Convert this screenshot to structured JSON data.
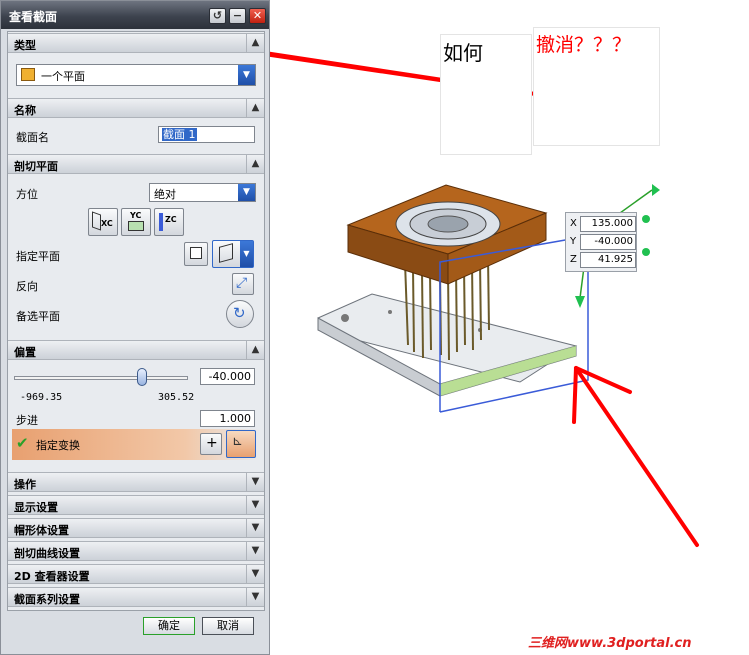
{
  "dialog": {
    "title": "查看截面",
    "sections": {
      "type": {
        "header": "类型",
        "value": "一个平面"
      },
      "name": {
        "header": "名称",
        "label": "截面名",
        "value": "截面 1"
      },
      "cutting_plane": {
        "header": "剖切平面",
        "orientation_label": "方位",
        "orientation_value": "绝对",
        "axis_buttons": [
          "XC",
          "YC",
          "ZC"
        ],
        "specify_plane_label": "指定平面",
        "reverse_label": "反向",
        "alternate_plane_label": "备选平面"
      },
      "offset": {
        "header": "偏置",
        "value": "-40.000",
        "slider_min": "-969.35",
        "slider_max": "305.52",
        "slider_fraction": 0.73,
        "step_label": "步进",
        "step_value": "1.000",
        "specify_transform_label": "指定变换"
      },
      "collapsed": [
        "操作",
        "显示设置",
        "帽形体设置",
        "剖切曲线设置",
        "2D 查看器设置",
        "截面系列设置"
      ]
    },
    "ok_label": "确定",
    "cancel_label": "取消"
  },
  "annotations": {
    "note1": "如何",
    "note2": "撤消？？？"
  },
  "coords": {
    "x_label": "X",
    "x_value": "135.000",
    "y_label": "Y",
    "y_value": "-40.000",
    "z_label": "Z",
    "z_value": "41.925"
  },
  "watermark": "三维网www.3dportal.cn",
  "colors": {
    "accent_red": "#ff0000",
    "model_orange": "#b5651d",
    "plane_blue": "#3a5bd8",
    "transform_bar": "#e8a070"
  }
}
